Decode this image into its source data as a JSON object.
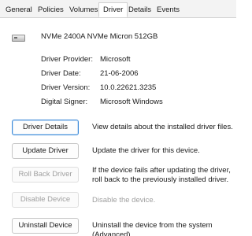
{
  "tabs": [
    {
      "label": "General"
    },
    {
      "label": "Policies"
    },
    {
      "label": "Volumes"
    },
    {
      "label": "Driver",
      "active": true
    },
    {
      "label": "Details"
    },
    {
      "label": "Events"
    }
  ],
  "device": {
    "icon": "drive-icon",
    "name": "NVMe 2400A NVMe Micron 512GB"
  },
  "properties": [
    {
      "label": "Driver Provider:",
      "value": "Microsoft"
    },
    {
      "label": "Driver Date:",
      "value": "21-06-2006"
    },
    {
      "label": "Driver Version:",
      "value": "10.0.22621.3235"
    },
    {
      "label": "Digital Signer:",
      "value": "Microsoft Windows"
    }
  ],
  "actions": [
    {
      "button": "Driver Details",
      "description": "View details about the installed driver files.",
      "enabled": true
    },
    {
      "button": "Update Driver",
      "description": "Update the driver for this device.",
      "enabled": true
    },
    {
      "button": "Roll Back Driver",
      "description": "If the device fails after updating the driver, roll back to the previously installed driver.",
      "enabled": false
    },
    {
      "button": "Disable Device",
      "description": "Disable the device.",
      "enabled": false
    },
    {
      "button": "Uninstall Device",
      "description": "Uninstall the device from the system (Advanced).",
      "enabled": true
    }
  ]
}
